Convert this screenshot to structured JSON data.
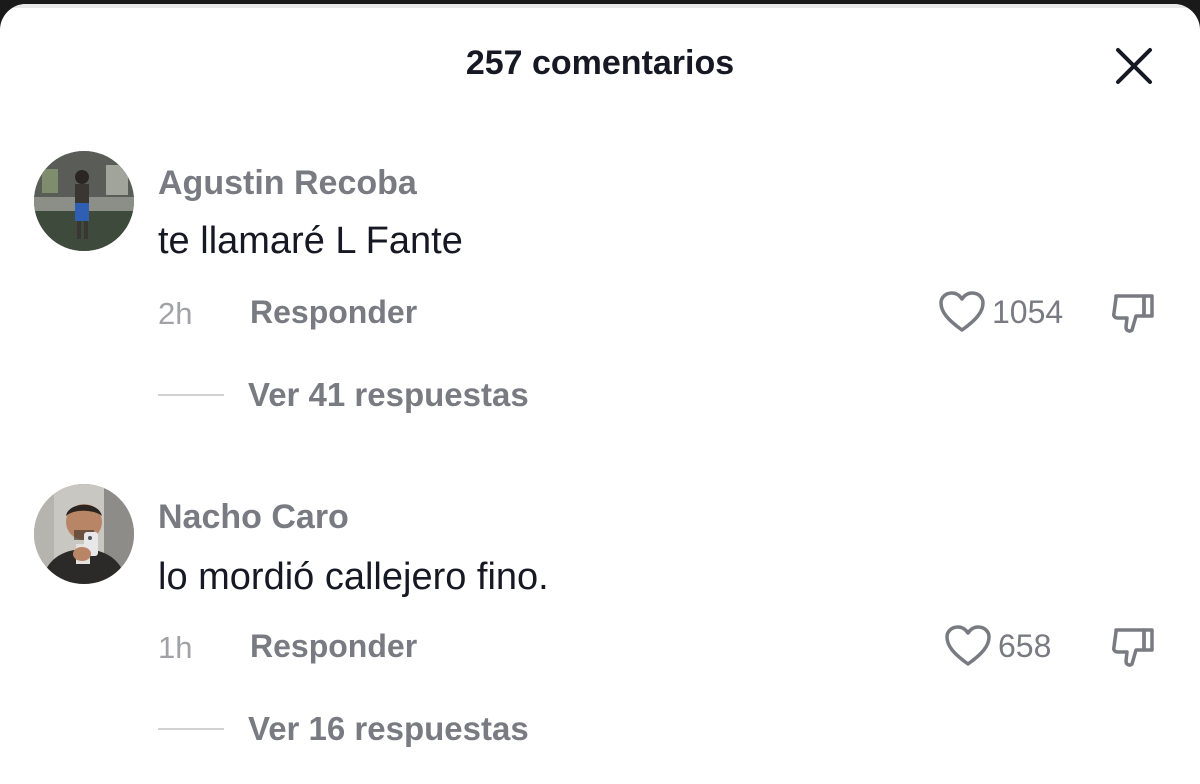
{
  "header": {
    "title": "257 comentarios",
    "close_icon": "close-icon"
  },
  "comments": [
    {
      "username": "Agustin Recoba",
      "text": "te llamaré L Fante",
      "time": "2h",
      "reply_label": "Responder",
      "likes": "1054",
      "replies_label": "Ver 41 respuestas"
    },
    {
      "username": "Nacho Caro",
      "text": "lo mordió callejero fino.",
      "time": "1h",
      "reply_label": "Responder",
      "likes": "658",
      "replies_label": "Ver 16 respuestas"
    }
  ],
  "icons": {
    "like": "heart-outline-icon",
    "dislike": "thumbs-down-icon",
    "close": "close-icon"
  },
  "colors": {
    "background": "#ffffff",
    "primary_text": "#161823",
    "secondary_text": "#7a7b82",
    "muted_text": "#a1a2a7"
  }
}
